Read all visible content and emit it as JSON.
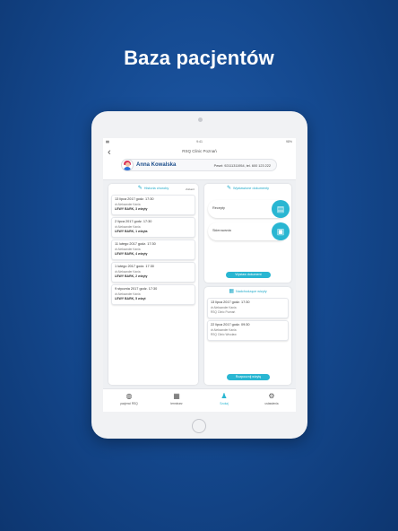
{
  "headline": "Baza pacjentów",
  "status_bar": {
    "left": "▮▮",
    "time": "9:41",
    "battery": "98%"
  },
  "topbar": {
    "clinic": "RSQ Clinic Poznań"
  },
  "patient": {
    "name": "Anna Kowalska",
    "contact": "Pesel: 92111311954, tel. 600 123 222"
  },
  "history": {
    "title": "Historia choroby",
    "subtitle": "Zobacz",
    "visits": [
      {
        "date": "13 lipca 2017 godz. 17:30",
        "doctor": "dr Aleksander Kania",
        "note": "LEWY BARK, 3 wizyty"
      },
      {
        "date": "2 lipca 2017 godz. 17:30",
        "doctor": "dr Aleksander Kania",
        "note": "LEWY BARK, 1 wizyta"
      },
      {
        "date": "11 lutego 2017 godz. 17:30",
        "doctor": "dr Aleksander Kania",
        "note": "LEWY BARK, 4 wizyty"
      },
      {
        "date": "1 lutego 2017 godz. 17:30",
        "doctor": "dr Aleksander Kania",
        "note": "LEWY BARK, 2 wizyty"
      },
      {
        "date": "9 stycznia 2017 godz. 17:30",
        "doctor": "dr Aleksander Kania",
        "note": "LEWY BARK, 5 wizyt"
      }
    ]
  },
  "documents": {
    "title": "Wystawione dokumenty",
    "items": [
      {
        "label": "Recepty",
        "icon": "prescription-icon"
      },
      {
        "label": "Skierowania",
        "icon": "referral-icon"
      }
    ],
    "button": "Wystaw dokument"
  },
  "upcoming": {
    "title": "Nadchodzące wizyty",
    "visits": [
      {
        "date": "13 lipca 2017 godz. 17:30",
        "doctor": "dr Aleksander Kania",
        "place": "RSQ Clinic Poznań"
      },
      {
        "date": "22 lipca 2017 godz. 09:30",
        "doctor": "dr Aleksander Kania",
        "place": "RSQ Clinic Wrocław"
      }
    ],
    "button": "Rozpocznij wizytę"
  },
  "bottom_nav": [
    {
      "label": "pacjenci RSQ",
      "icon": "patients-icon"
    },
    {
      "label": "terminarz",
      "icon": "calendar-icon"
    },
    {
      "label": "Szukaj",
      "icon": "person-icon",
      "active": true
    },
    {
      "label": "ustawienia",
      "icon": "gear-icon"
    }
  ],
  "colors": {
    "background": "#154a91",
    "accent": "#29b6d2",
    "name": "#1d4f8c"
  }
}
